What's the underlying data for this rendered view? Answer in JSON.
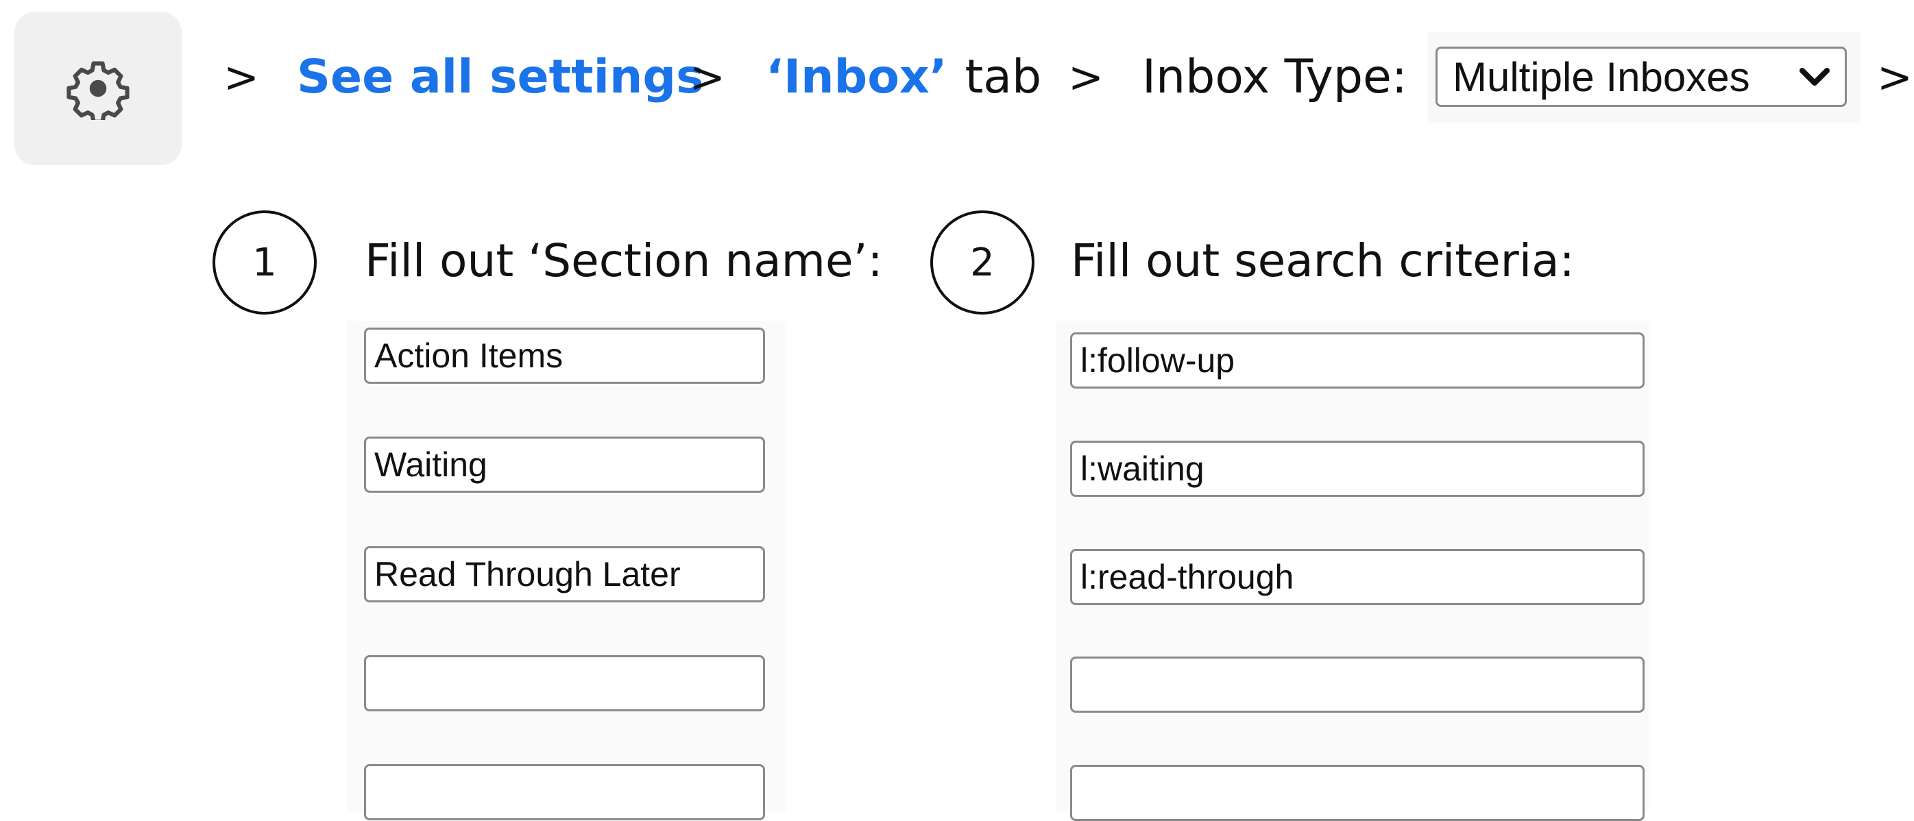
{
  "breadcrumb": {
    "separator": ">",
    "see_all_settings": "See all settings",
    "inbox_tab_name": "‘Inbox’",
    "inbox_tab_suffix": "tab",
    "inbox_type_label": "Inbox Type:",
    "inbox_type_value": "Multiple Inboxes"
  },
  "icons": {
    "settings": "gear-icon",
    "dropdown": "chevron-down-icon"
  },
  "colors": {
    "link": "#1a73e8",
    "tile": "#f0f0f0"
  },
  "steps": [
    {
      "number": "1",
      "title": "Fill out ‘Section name’:"
    },
    {
      "number": "2",
      "title": "Fill out search criteria:"
    }
  ],
  "section_names": [
    "Action Items",
    "Waiting",
    "Read Through Later",
    "",
    ""
  ],
  "search_criteria": [
    "l:follow-up",
    "l:waiting",
    "l:read-through",
    "",
    ""
  ]
}
